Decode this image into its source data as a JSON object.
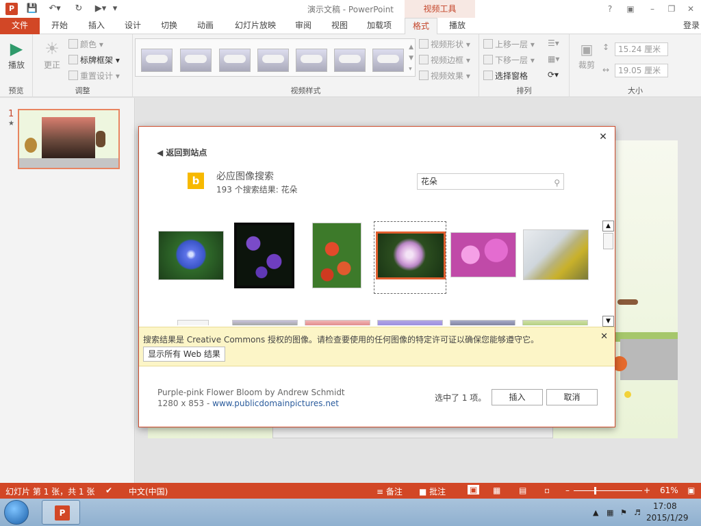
{
  "app": {
    "title": "演示文稿 - PowerPoint",
    "tool_tab_title": "视频工具",
    "login": "登录",
    "ppt_icon": "P"
  },
  "tabs": [
    {
      "label": "文件"
    },
    {
      "label": "开始"
    },
    {
      "label": "插入"
    },
    {
      "label": "设计"
    },
    {
      "label": "切换"
    },
    {
      "label": "动画"
    },
    {
      "label": "幻灯片放映"
    },
    {
      "label": "审阅"
    },
    {
      "label": "视图"
    },
    {
      "label": "加载项"
    },
    {
      "label": "格式"
    },
    {
      "label": "播放"
    }
  ],
  "ribbon": {
    "preview": {
      "group": "预览",
      "play": "播放"
    },
    "adjust": {
      "group": "调整",
      "correct": "更正",
      "color": "颜色",
      "poster_frame": "标牌框架",
      "reset_design": "重置设计"
    },
    "video_styles": {
      "group": "视频样式",
      "shape": "视频形状",
      "border": "视频边框",
      "effects": "视频效果"
    },
    "arrange": {
      "group": "排列",
      "bring_forward": "上移一层",
      "send_backward": "下移一层",
      "selection_pane": "选择窗格"
    },
    "size": {
      "group": "大小",
      "crop": "裁剪",
      "height": "15.24 厘米",
      "width": "19.05 厘米"
    }
  },
  "slide_panel": {
    "number": "1",
    "star": "★"
  },
  "dialog": {
    "back": "返回到站点",
    "search_title": "必应图像搜索",
    "result_count": "193 个搜索结果: 花朵",
    "search_value": "花朵",
    "bing_letter": "b",
    "notice": "搜索结果是 Creative Commons 授权的图像。请检查要使用的任何图像的特定许可证以确保您能够遵守它。",
    "show_all": "显示所有 Web 结果",
    "image_title": "Purple-pink Flower Bloom by Andrew Schmidt",
    "image_size": "1280 x 853 - ",
    "image_source": "www.publicdomainpictures.net",
    "selected_count": "选中了 1 项。",
    "insert": "插入",
    "cancel": "取消"
  },
  "status": {
    "slide_info": "幻灯片 第 1 张，共 1 张",
    "language": "中文(中国)",
    "notes": "备注",
    "comments": "批注",
    "zoom": "61%"
  },
  "taskbar": {
    "time": "17:08",
    "date": "2015/1/29"
  },
  "colors": {
    "accent": "#d24726",
    "selection": "#e05f2f",
    "notice_bg": "#fcf5c7",
    "bing": "#f7b900"
  }
}
